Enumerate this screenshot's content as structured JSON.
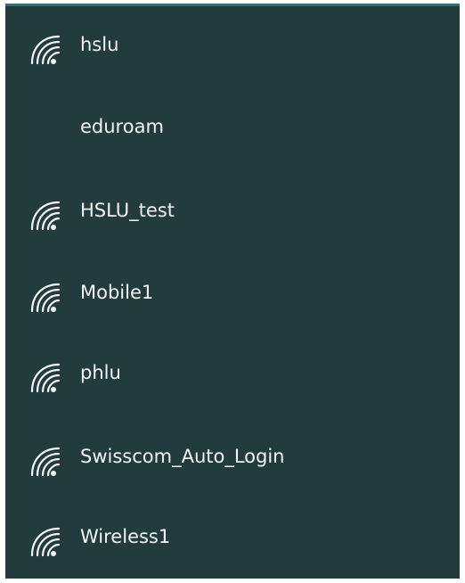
{
  "networks": [
    {
      "name": "hslu",
      "icon": "wifi-signal-icon",
      "has_icon": true
    },
    {
      "name": "eduroam",
      "icon": "",
      "has_icon": false
    },
    {
      "name": "HSLU_test",
      "icon": "wifi-signal-icon",
      "has_icon": true
    },
    {
      "name": "Mobile1",
      "icon": "wifi-signal-icon",
      "has_icon": true
    },
    {
      "name": "phlu",
      "icon": "wifi-signal-icon",
      "has_icon": true
    },
    {
      "name": "Swisscom_Auto_Login",
      "icon": "wifi-signal-icon",
      "has_icon": true
    },
    {
      "name": "Wireless1",
      "icon": "wifi-signal-icon",
      "has_icon": true
    }
  ],
  "colors": {
    "panel_background": "#223c3e",
    "panel_top_border": "#2f6f72",
    "text": "#f2f5f5",
    "icon": "#f2f5f5"
  }
}
